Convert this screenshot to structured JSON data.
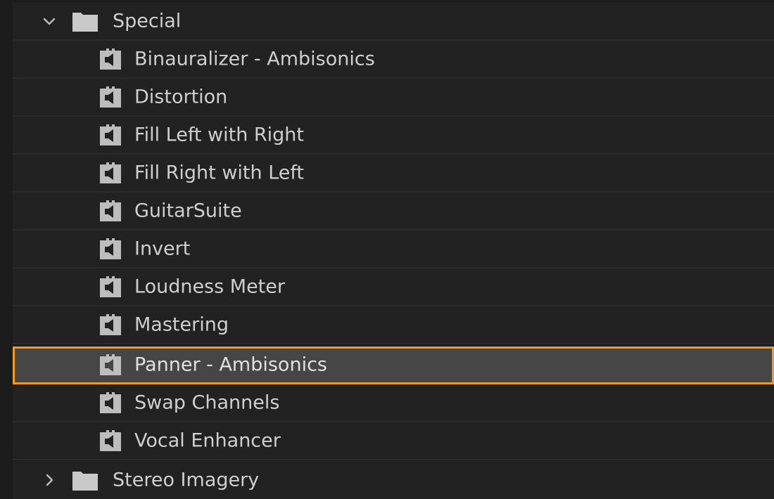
{
  "tree": {
    "special_folder": {
      "label": "Special",
      "expanded": true,
      "icon": "folder-icon",
      "chevron": "chevron-down-icon"
    },
    "effects": [
      {
        "label": "Binauralizer - Ambisonics",
        "icon": "audio-effect-icon",
        "selected": false
      },
      {
        "label": "Distortion",
        "icon": "audio-effect-icon",
        "selected": false
      },
      {
        "label": "Fill Left with Right",
        "icon": "audio-effect-icon",
        "selected": false
      },
      {
        "label": "Fill Right with Left",
        "icon": "audio-effect-icon",
        "selected": false
      },
      {
        "label": "GuitarSuite",
        "icon": "audio-effect-icon",
        "selected": false
      },
      {
        "label": "Invert",
        "icon": "audio-effect-icon",
        "selected": false
      },
      {
        "label": "Loudness Meter",
        "icon": "audio-effect-icon",
        "selected": false
      },
      {
        "label": "Mastering",
        "icon": "audio-effect-icon",
        "selected": false
      },
      {
        "label": "Panner - Ambisonics",
        "icon": "audio-effect-icon",
        "selected": true
      },
      {
        "label": "Swap Channels",
        "icon": "audio-effect-icon",
        "selected": false
      },
      {
        "label": "Vocal Enhancer",
        "icon": "audio-effect-icon",
        "selected": false
      }
    ],
    "stereo_folder": {
      "label": "Stereo Imagery",
      "expanded": false,
      "icon": "folder-icon",
      "chevron": "chevron-right-icon"
    }
  },
  "colors": {
    "selection_outline": "#f29b1e",
    "selected_background": "#464646",
    "row_background": "#222222",
    "text": "#cfcfcf"
  }
}
